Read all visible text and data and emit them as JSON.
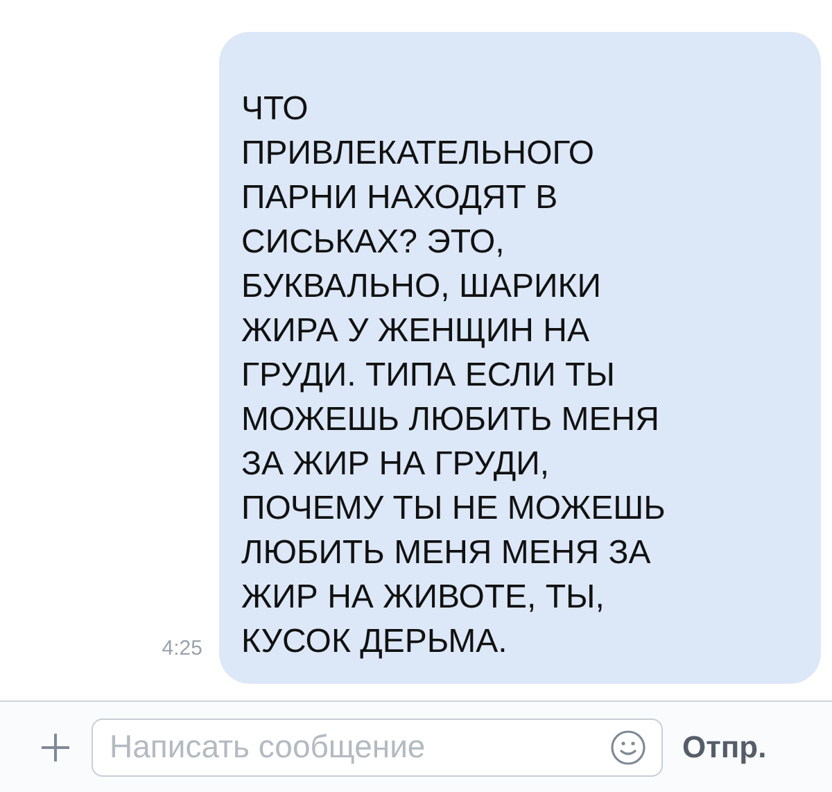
{
  "message": {
    "lines": [
      "ЧТО",
      "ПРИВЛЕКАТЕЛЬНОГО",
      "ПАРНИ НАХОДЯТ В",
      "СИСЬКАХ? ЭТО,",
      "БУКВАЛЬНО, ШАРИКИ",
      "ЖИРА У ЖЕНЩИН НА",
      "ГРУДИ. ТИПА ЕСЛИ ТЫ",
      "МОЖЕШЬ ЛЮБИТЬ МЕНЯ",
      "ЗА ЖИР НА ГРУДИ,",
      "ПОЧЕМУ ТЫ НЕ МОЖЕШЬ",
      "ЛЮБИТЬ МЕНЯ МЕНЯ ЗА",
      "ЖИР НА ЖИВОТЕ, ТЫ,",
      "КУСОК ДЕРЬМА."
    ],
    "time": "4:25"
  },
  "composer": {
    "placeholder": "Написать сообщение",
    "send": "Отпр."
  }
}
